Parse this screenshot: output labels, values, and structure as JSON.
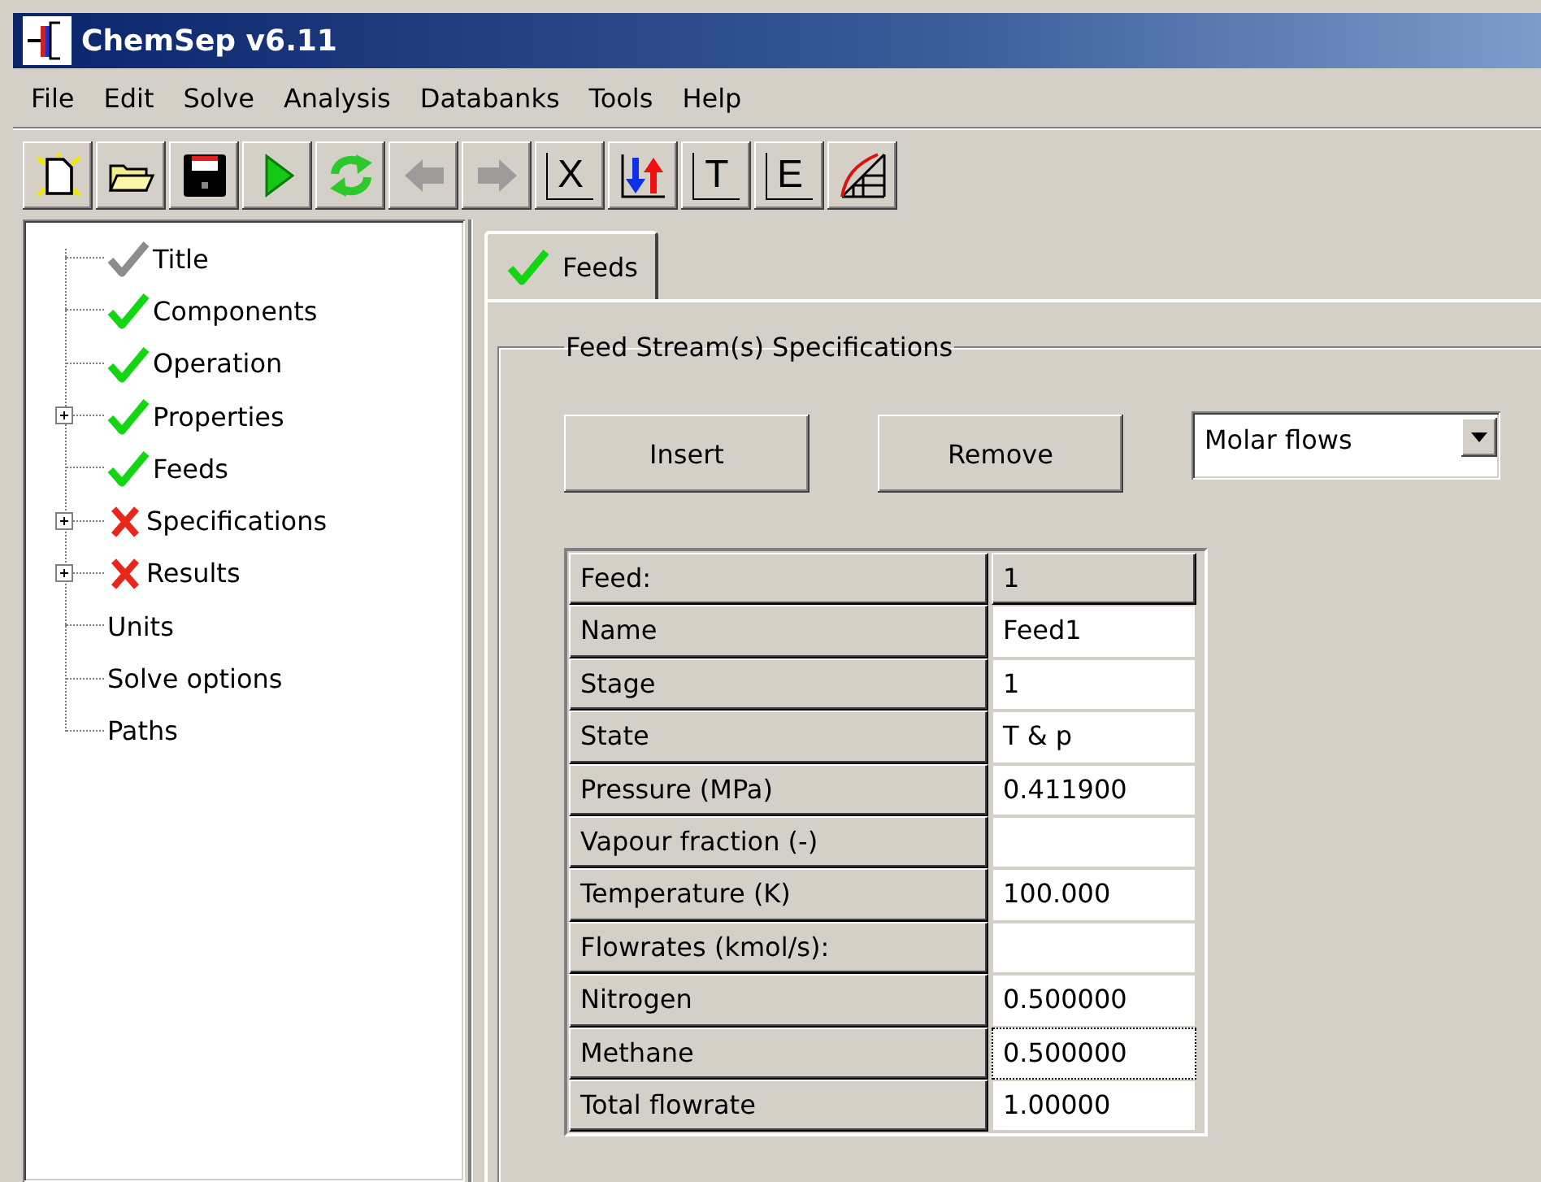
{
  "window": {
    "title": "ChemSep v6.11"
  },
  "menu": [
    "File",
    "Edit",
    "Solve",
    "Analysis",
    "Databanks",
    "Tools",
    "Help"
  ],
  "toolbar": [
    {
      "kind": "new",
      "disabled": false
    },
    {
      "kind": "open",
      "disabled": false
    },
    {
      "kind": "save",
      "disabled": false
    },
    {
      "kind": "run",
      "disabled": false
    },
    {
      "kind": "reload",
      "disabled": false
    },
    {
      "kind": "back",
      "disabled": true
    },
    {
      "kind": "forward",
      "disabled": true
    },
    {
      "kind": "letter",
      "label": "X",
      "disabled": false
    },
    {
      "kind": "arrows",
      "disabled": false
    },
    {
      "kind": "letter",
      "label": "T",
      "disabled": false
    },
    {
      "kind": "letter",
      "label": "E",
      "disabled": false
    },
    {
      "kind": "diagram",
      "disabled": false
    }
  ],
  "tree": [
    {
      "label": "Title",
      "kind": "greycheck",
      "expandable": false
    },
    {
      "label": "Components",
      "kind": "check",
      "expandable": false
    },
    {
      "label": "Operation",
      "kind": "check",
      "expandable": false
    },
    {
      "label": "Properties",
      "kind": "check",
      "expandable": true
    },
    {
      "label": "Feeds",
      "kind": "check",
      "expandable": false
    },
    {
      "label": "Specifications",
      "kind": "cross",
      "expandable": true
    },
    {
      "label": "Results",
      "kind": "cross",
      "expandable": true
    },
    {
      "label": "Units",
      "kind": "plain",
      "expandable": false
    },
    {
      "label": "Solve options",
      "kind": "plain",
      "expandable": false
    },
    {
      "label": "Paths",
      "kind": "plain",
      "expandable": false
    }
  ],
  "tabs": [
    {
      "label": "Feeds",
      "selected": true,
      "kind": "check"
    }
  ],
  "group": {
    "title": "Feed Stream(s) Specifications"
  },
  "buttons": [
    "Insert",
    "Remove"
  ],
  "dropdown": {
    "value": "Molar flows"
  },
  "table": {
    "rows": [
      {
        "kind": "header",
        "label": "Feed:",
        "value": "1",
        "focused": false
      },
      {
        "kind": "input",
        "label": "Name",
        "value": "Feed1",
        "focused": false
      },
      {
        "kind": "input",
        "label": "Stage",
        "value": "1",
        "focused": false
      },
      {
        "kind": "input",
        "label": "State",
        "value": "T & p",
        "focused": false
      },
      {
        "kind": "input",
        "label": "Pressure (MPa)",
        "value": "0.411900",
        "focused": false
      },
      {
        "kind": "input",
        "label": "Vapour fraction (-)",
        "focused": false
      },
      {
        "kind": "input",
        "label": "Temperature (K)",
        "value": "100.000",
        "focused": false
      },
      {
        "kind": "input",
        "label": "Flowrates (kmol/s):",
        "focused": false
      },
      {
        "kind": "input",
        "label": "Nitrogen",
        "value": "0.500000",
        "focused": false
      },
      {
        "kind": "input",
        "label": "Methane",
        "value": "0.500000",
        "focused": true
      },
      {
        "kind": "input",
        "label": "Total flowrate",
        "value": "1.00000",
        "focused": false
      }
    ]
  }
}
